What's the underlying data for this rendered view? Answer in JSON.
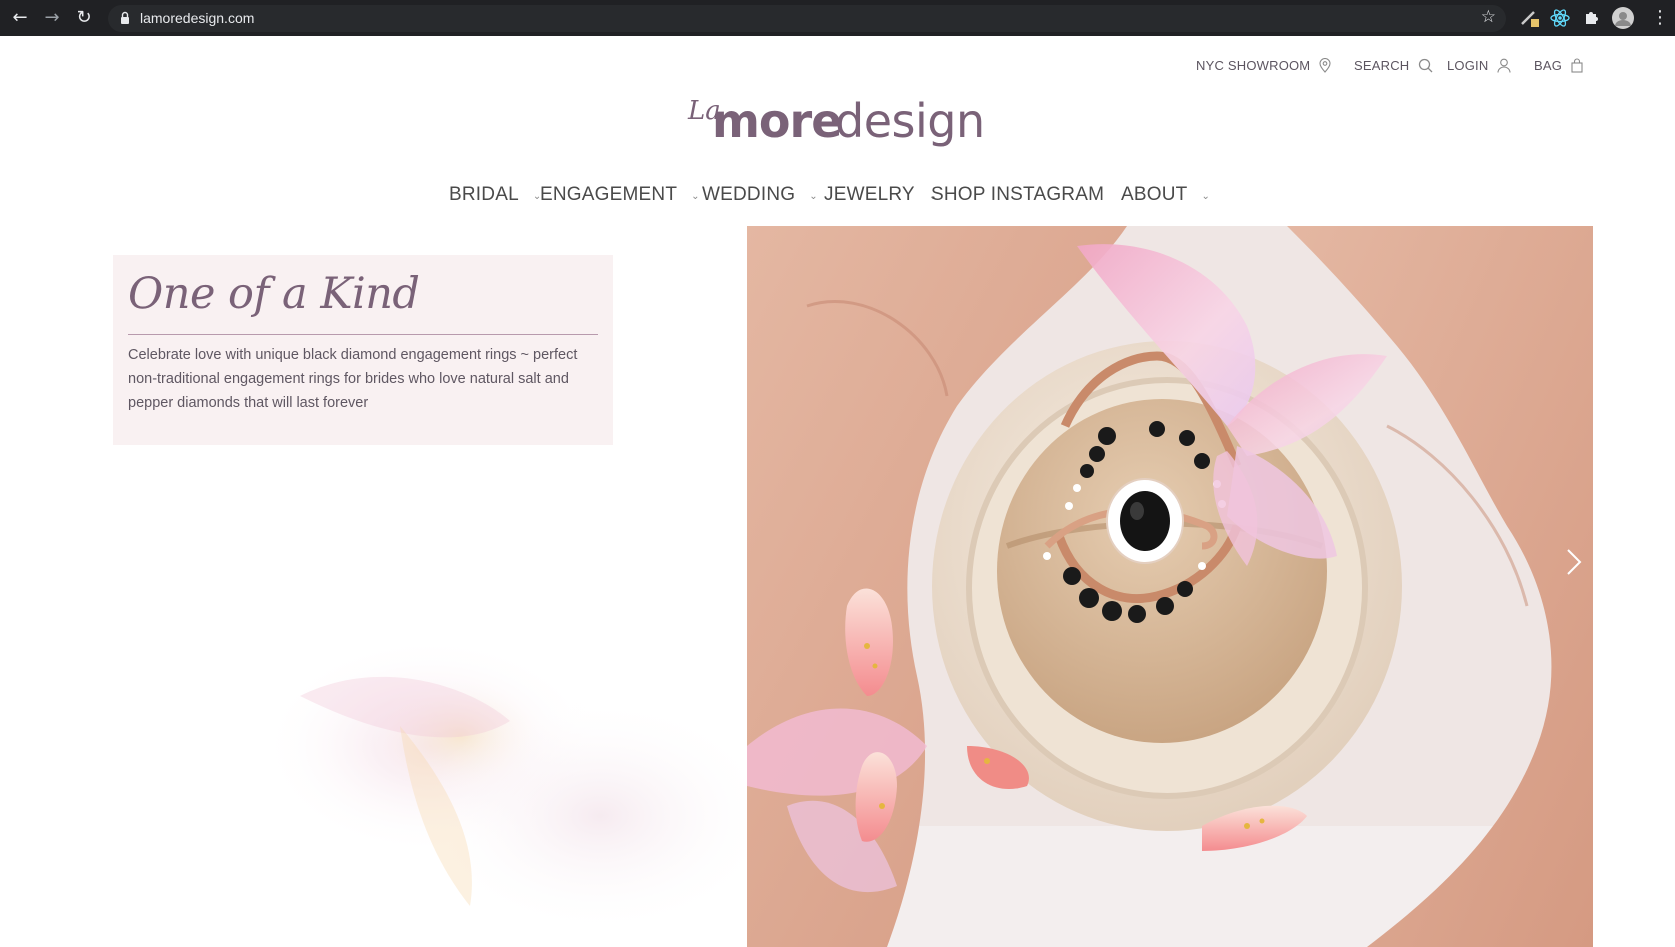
{
  "browser": {
    "url": "lamoredesign.com",
    "back_icon": "arrow-left-icon",
    "forward_icon": "arrow-right-icon",
    "reload_icon": "reload-icon",
    "bookmark_icon": "star-icon"
  },
  "utility_nav": {
    "showroom": "NYC SHOWROOM",
    "search": "SEARCH",
    "login": "LOGIN",
    "bag": "BAG"
  },
  "logo": {
    "la": "La",
    "more": "more",
    "design": "design"
  },
  "main_nav": {
    "bridal": "BRIDAL",
    "engagement": "ENGAGEMENT",
    "wedding": "WEDDING",
    "jewelry": "JEWELRY",
    "shop_instagram": "SHOP INSTAGRAM",
    "about": "ABOUT"
  },
  "hero": {
    "title": "One of a Kind",
    "description": "Celebrate love with unique black diamond engagement rings ~ perfect non-traditional engagement rings for brides who love natural salt and pepper diamonds that will last forever",
    "next_icon": "chevron-right-icon"
  },
  "colors": {
    "brand": "#7a6278",
    "copy_box_bg": "#f9f1f2",
    "nav_text": "#4a4a4a",
    "chrome_bg": "#202124"
  }
}
